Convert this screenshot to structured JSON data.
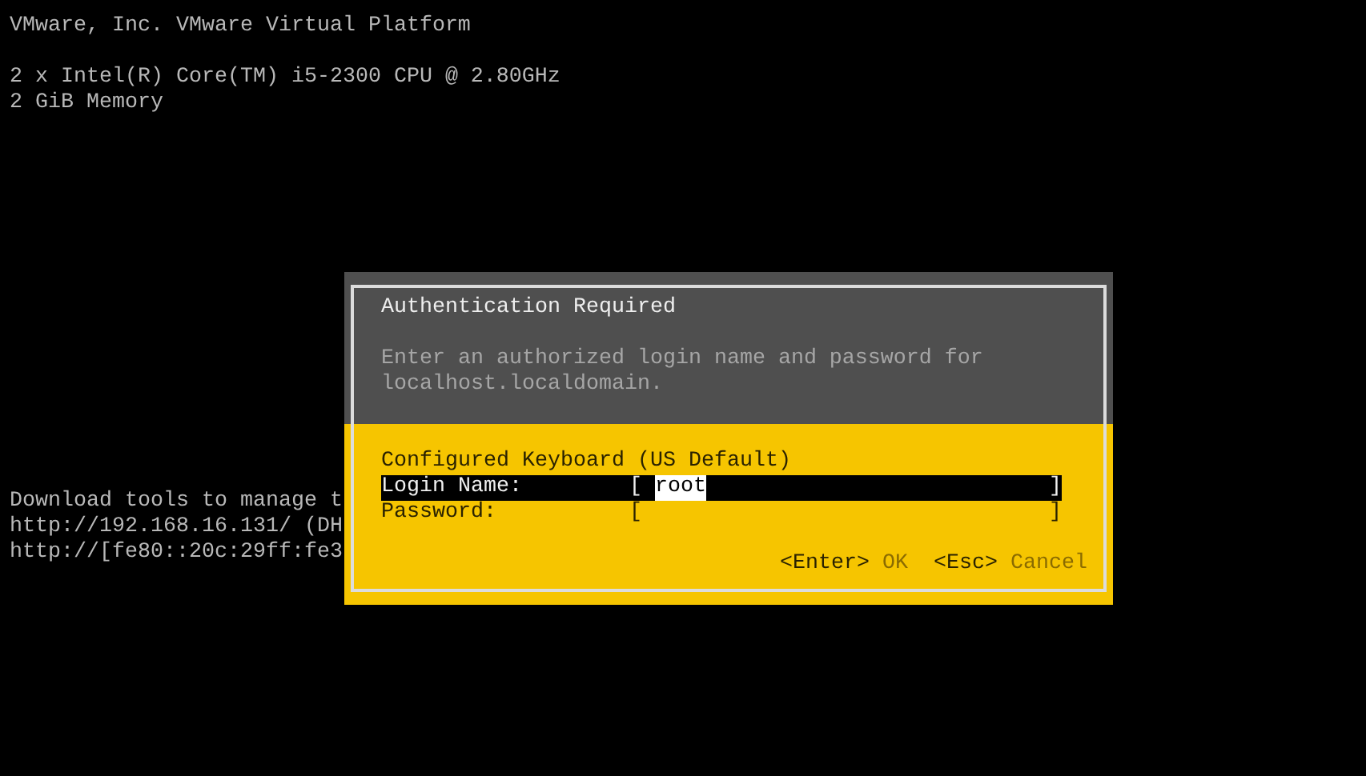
{
  "platform": "VMware, Inc. VMware Virtual Platform",
  "hardware": [
    "2 x Intel(R) Core(TM) i5-2300 CPU @ 2.80GHz",
    "2 GiB Memory"
  ],
  "management_info": [
    "Download tools to manage t",
    "http://192.168.16.131/ (DH",
    "http://[fe80::20c:29ff:fe3"
  ],
  "dialog": {
    "title": "Authentication Required",
    "description": "Enter an authorized login name and password for localhost.localdomain.",
    "keyboard": "Configured Keyboard (US Default)",
    "fields": [
      {
        "label": "Login Name:",
        "bracket_open": "[",
        "value": "root",
        "bracket_close": "]",
        "selected": true
      },
      {
        "label": "Password:",
        "bracket_open": "[",
        "bracket_close": "]",
        "selected": false
      }
    ],
    "buttons": [
      {
        "key": "<Enter>",
        "label": "OK"
      },
      {
        "key": "<Esc>",
        "label": "Cancel"
      }
    ]
  }
}
